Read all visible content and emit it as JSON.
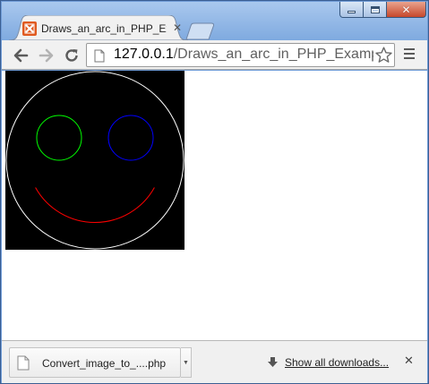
{
  "tab": {
    "title": "Draws_an_arc_in_PHP_Exa"
  },
  "address_bar": {
    "host": "127.0.0.1",
    "path": "/Draws_an_arc_in_PHP_Example."
  },
  "colors": {
    "face_outline": "#ffffff",
    "left_eye": "#00ff00",
    "right_eye": "#0000ff",
    "mouth": "#ff0000",
    "canvas_background": "#000000"
  },
  "downloads": {
    "item_name": "Convert_image_to_....php",
    "show_all_label": "Show all downloads..."
  },
  "icons": {
    "tab_favicon": "xampp-icon",
    "tab_close": "close-icon",
    "back": "back-arrow-icon",
    "forward": "forward-arrow-icon",
    "reload": "reload-icon",
    "page": "page-icon",
    "bookmark": "star-icon",
    "menu": "hamburger-menu-icon",
    "download_file": "file-icon",
    "show_all": "download-arrow-icon",
    "shelf_close": "close-icon"
  }
}
